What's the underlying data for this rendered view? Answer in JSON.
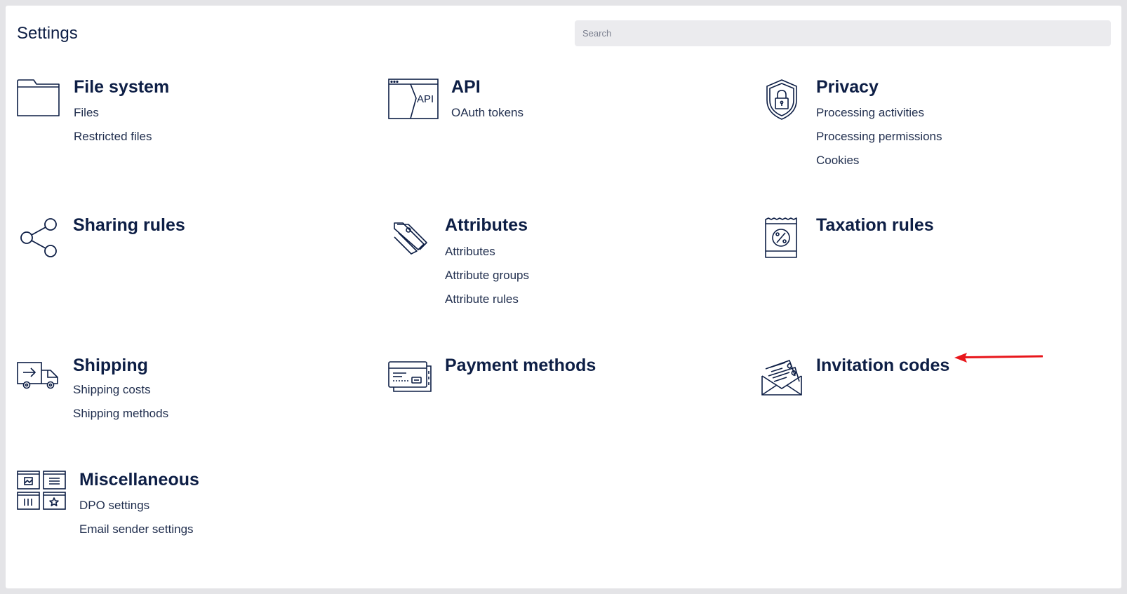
{
  "page": {
    "title": "Settings"
  },
  "search": {
    "placeholder": "Search"
  },
  "sections": {
    "file_system": {
      "title": "File system",
      "links": [
        "Files",
        "Restricted files"
      ]
    },
    "api": {
      "title": "API",
      "icon_label": "API",
      "links": [
        "OAuth tokens"
      ]
    },
    "privacy": {
      "title": "Privacy",
      "links": [
        "Processing activities",
        "Processing permissions",
        "Cookies"
      ]
    },
    "sharing_rules": {
      "title": "Sharing rules",
      "links": []
    },
    "attributes": {
      "title": "Attributes",
      "links": [
        "Attributes",
        "Attribute groups",
        "Attribute rules"
      ]
    },
    "taxation_rules": {
      "title": "Taxation rules",
      "links": []
    },
    "shipping": {
      "title": "Shipping",
      "links": [
        "Shipping costs",
        "Shipping methods"
      ]
    },
    "payment_methods": {
      "title": "Payment methods",
      "links": []
    },
    "invitation_codes": {
      "title": "Invitation codes",
      "links": []
    },
    "miscellaneous": {
      "title": "Miscellaneous",
      "links": [
        "DPO settings",
        "Email sender settings"
      ]
    }
  },
  "icons": {
    "file_system": "folder-icon",
    "api": "api-window-icon",
    "privacy": "shield-lock-icon",
    "sharing_rules": "share-icon",
    "attributes": "tags-icon",
    "taxation_rules": "tax-receipt-icon",
    "shipping": "delivery-truck-icon",
    "payment_methods": "credit-card-icon",
    "invitation_codes": "envelope-cards-icon",
    "miscellaneous": "widgets-grid-icon"
  },
  "colors": {
    "text": "#0d1e45",
    "annotation_arrow": "#e8161b",
    "search_bg": "#ebebee"
  }
}
